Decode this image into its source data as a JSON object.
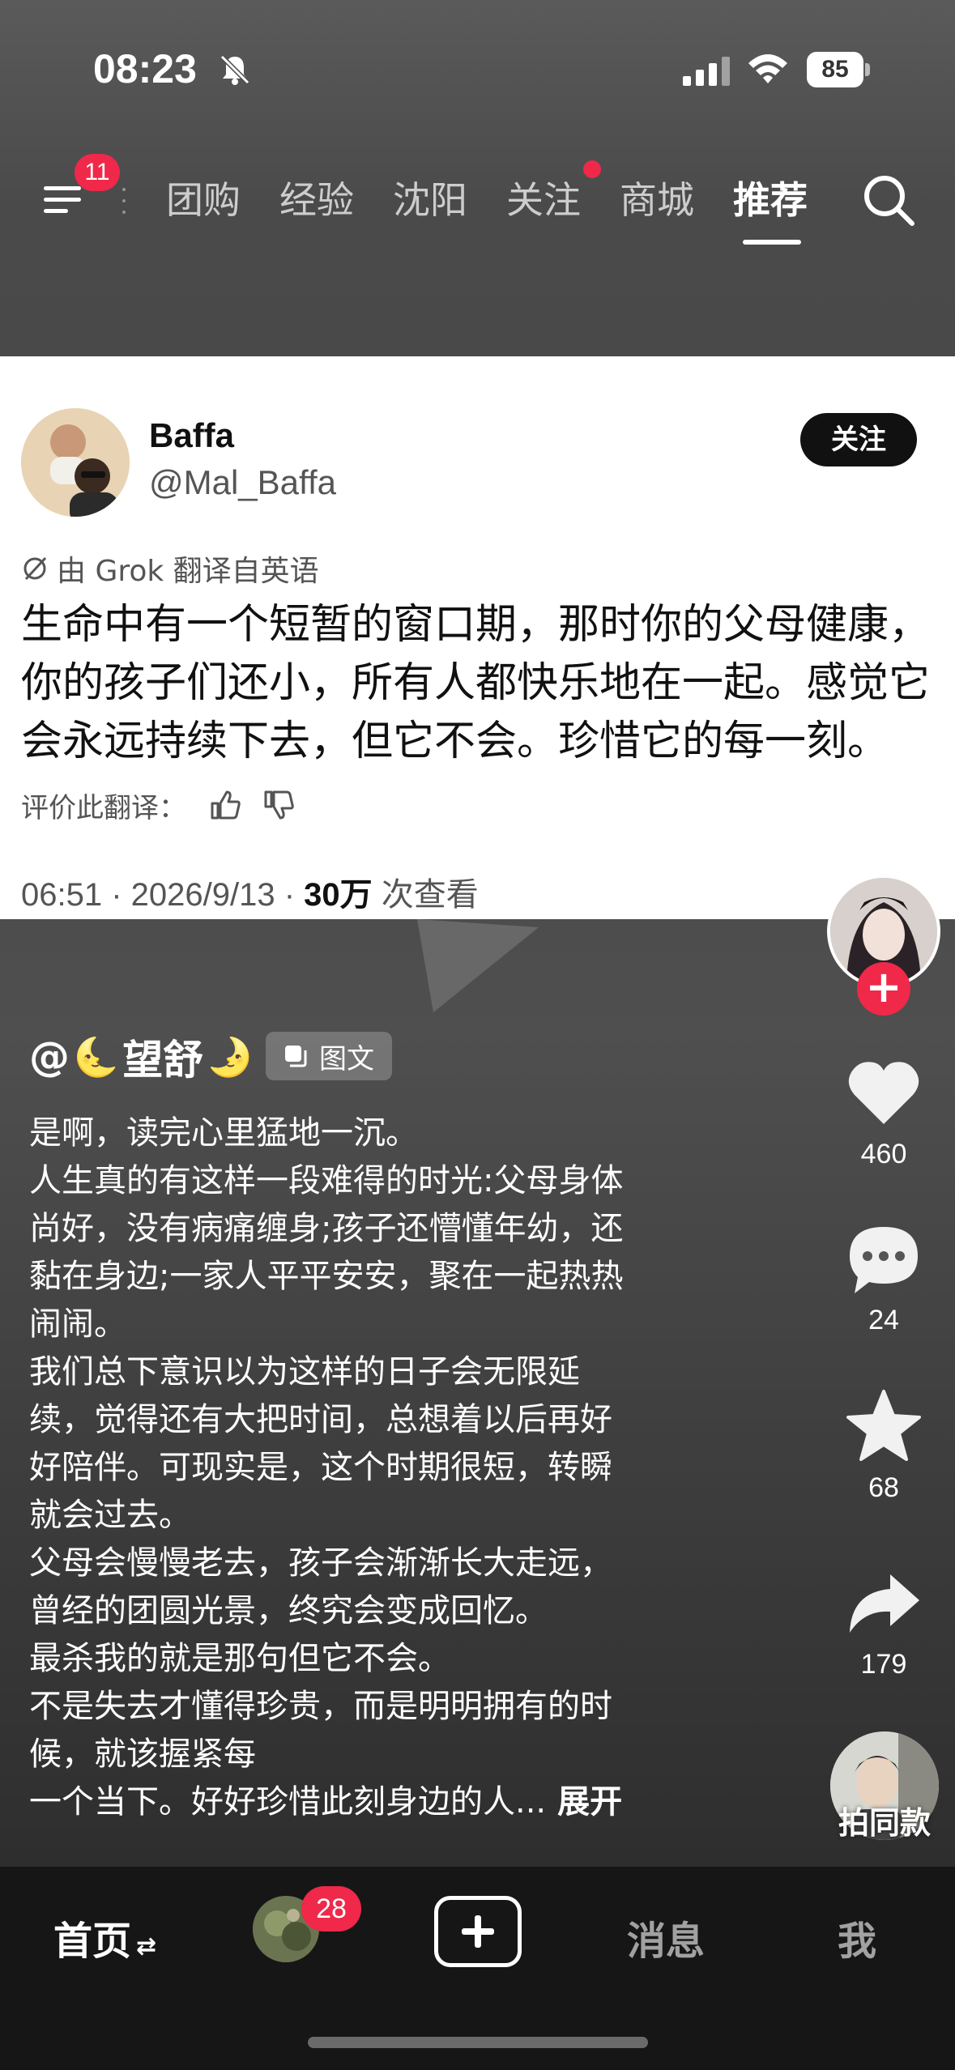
{
  "status_bar": {
    "time": "08:23",
    "battery": "85",
    "icons": [
      "bell-muted-icon",
      "signal-icon",
      "wifi-icon",
      "battery-icon"
    ]
  },
  "top_nav": {
    "menu_badge": "11",
    "tabs": [
      {
        "label": "团购"
      },
      {
        "label": "经验"
      },
      {
        "label": "沈阳"
      },
      {
        "label": "关注"
      },
      {
        "label": "商城"
      },
      {
        "label": "推荐"
      }
    ],
    "active_tab": "推荐",
    "icons": [
      "menu-icon",
      "search-icon"
    ]
  },
  "tweet": {
    "author_name": "Baffa",
    "author_handle": "@Mal_Baffa",
    "follow_label": "关注",
    "translation_note": "由 Grok 翻译自英语",
    "text_lines": [
      "生命中有一个短暂的窗口期，那时你的父母健康，",
      "你的孩子们还小，所有人都快乐地在一起。感觉它",
      "会永远持续下去，但它不会。珍惜它的每一刻。"
    ],
    "rate_label": "评价此翻译：",
    "meta_prefix": "06:51 · 2026/9/13 · ",
    "views_count": "30万",
    "views_suffix": " 次查看"
  },
  "post": {
    "author_name": "望舒",
    "author_prefix": "@",
    "tag_label": "图文",
    "lines": [
      "是啊，读完心里猛地一沉。",
      "人生真的有这样一段难得的时光:父母身体",
      "尚好，没有病痛缠身;孩子还懵懂年幼，还",
      "黏在身边;一家人平平安安，聚在一起热热",
      "闹闹。",
      "我们总下意识以为这样的日子会无限延",
      "续，觉得还有大把时间，总想着以后再好",
      "好陪伴。可现实是，这个时期很短，转瞬",
      "就会过去。",
      "父母会慢慢老去，孩子会渐渐长大走远，",
      "曾经的团圆光景，终究会变成回忆。",
      "最杀我的就是那句但它不会。",
      "不是失去才懂得珍贵，而是明明拥有的时",
      "候，就该握紧每"
    ],
    "last_line": "一个当下。好好珍惜此刻身边的人...",
    "expand_label": "展开"
  },
  "right_rail": {
    "like_count": "460",
    "comment_count": "24",
    "favorite_count": "68",
    "share_count": "179",
    "same_style_label": "拍同款"
  },
  "bottom_nav": {
    "home_label": "首页",
    "friends_badge": "28",
    "messages_label": "消息",
    "me_label": "我"
  }
}
